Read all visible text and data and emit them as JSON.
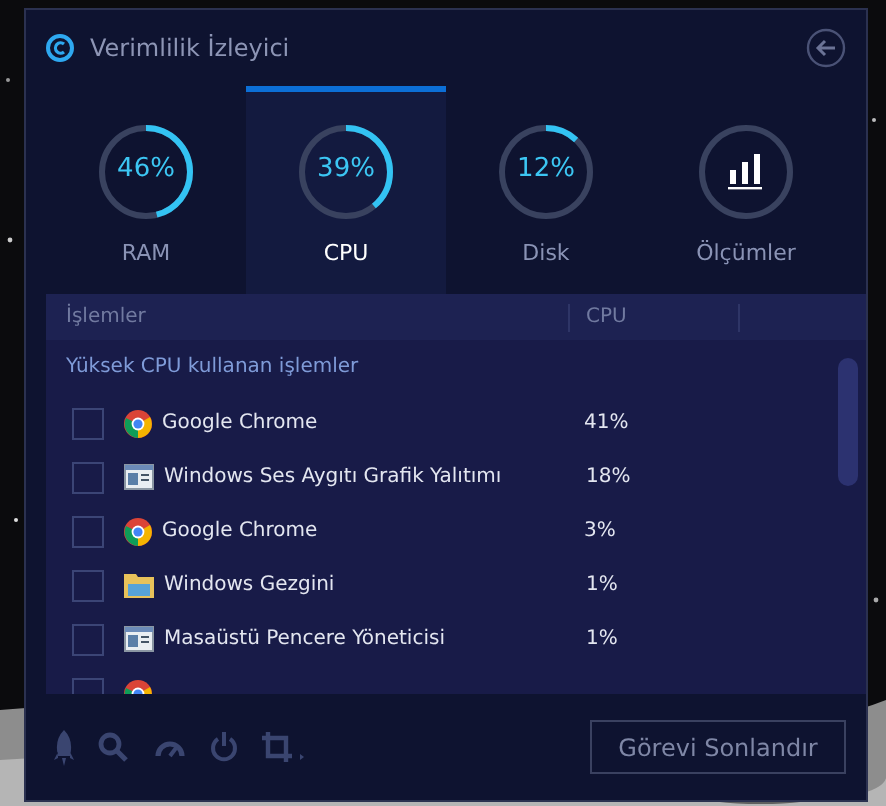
{
  "window": {
    "title": "Verimlilik İzleyici"
  },
  "tabs": [
    {
      "kind": "ring",
      "value": "46%",
      "level": 0.46,
      "label": "RAM",
      "selected": false
    },
    {
      "kind": "ring",
      "value": "39%",
      "level": 0.39,
      "label": "CPU",
      "selected": true
    },
    {
      "kind": "ring",
      "value": "12%",
      "level": 0.12,
      "label": "Disk",
      "selected": false
    },
    {
      "kind": "chart",
      "label": "Ölçümler",
      "selected": false
    }
  ],
  "table": {
    "columns": [
      "İşlemler",
      "CPU"
    ],
    "group": "Yüksek CPU kullanan işlemler",
    "rows": [
      {
        "kind": "chrome",
        "name": "Google Chrome",
        "cpu": "41%",
        "checked": false
      },
      {
        "kind": "window",
        "name": "Windows Ses Aygıtı Grafik Yalıtımı",
        "cpu": "18%",
        "checked": false
      },
      {
        "kind": "chrome",
        "name": "Google Chrome",
        "cpu": "3%",
        "checked": false
      },
      {
        "kind": "folder",
        "name": "Windows Gezgini",
        "cpu": "1%",
        "checked": false
      },
      {
        "kind": "window",
        "name": "Masaüstü Pencere Yöneticisi",
        "cpu": "1%",
        "checked": false
      },
      {
        "kind": "chrome",
        "checked": false
      }
    ]
  },
  "footer": {
    "button": "Görevi Sonlandır"
  }
}
